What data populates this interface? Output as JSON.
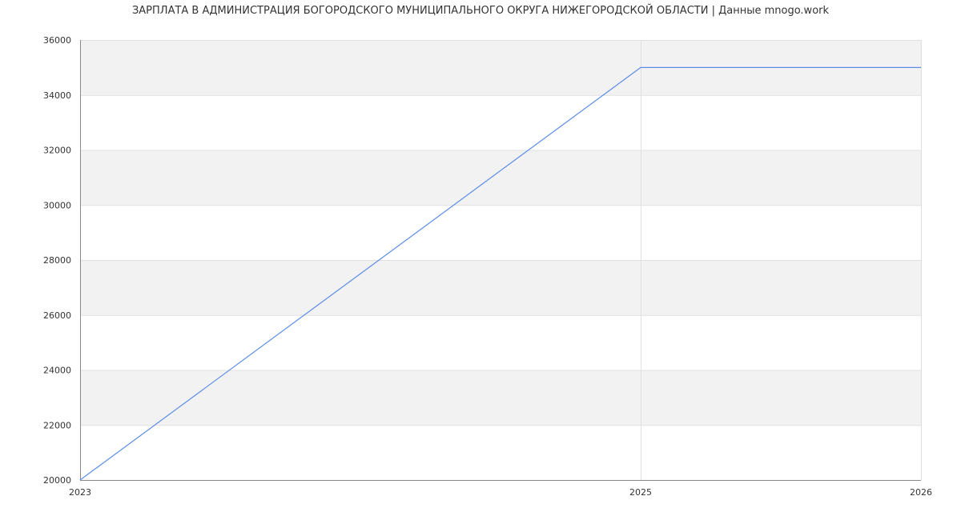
{
  "chart_data": {
    "type": "line",
    "title": "ЗАРПЛАТА В АДМИНИСТРАЦИЯ БОГОРОДСКОГО МУНИЦИПАЛЬНОГО ОКРУГА НИЖЕГОРОДСКОЙ ОБЛАСТИ | Данные mnogo.work",
    "xlabel": "",
    "ylabel": "",
    "x": [
      2023,
      2025,
      2026
    ],
    "series": [
      {
        "values": [
          20000,
          35000,
          35000
        ]
      }
    ],
    "xlim": [
      2023,
      2026
    ],
    "ylim": [
      20000,
      36000
    ],
    "x_ticks": [
      "2023",
      "2025",
      "2026"
    ],
    "y_ticks": [
      "20000",
      "22000",
      "24000",
      "26000",
      "28000",
      "30000",
      "32000",
      "34000",
      "36000"
    ],
    "grid": true,
    "alternating_bands": true,
    "legend": "none",
    "colors": {
      "line": "#5b8de8",
      "band": "#f2f2f2",
      "grid": "#e0e0e0",
      "axis": "#888888"
    }
  }
}
